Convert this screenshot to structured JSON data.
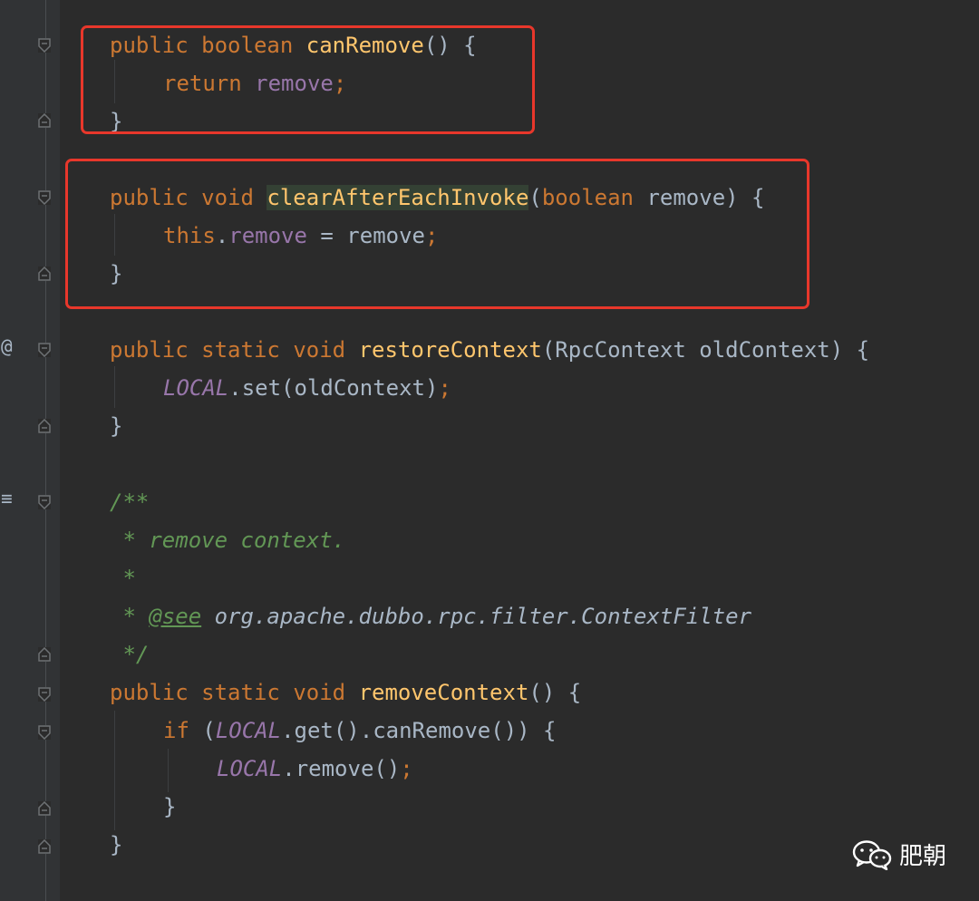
{
  "gutter": {
    "override_marker": "@",
    "doc_marker": "≡"
  },
  "code": {
    "canRemove": {
      "l1": {
        "kw1": "public",
        "kw2": "boolean",
        "name": "canRemove",
        "rest": "() {"
      },
      "l2": {
        "kw": "return",
        "field": "remove",
        "semi": ";"
      },
      "l3": {
        "brace": "}"
      }
    },
    "clearAfter": {
      "l1": {
        "kw1": "public",
        "kw2": "void",
        "name": "clearAfterEachInvoke",
        "open": "(",
        "kw3": "boolean",
        "param": "remove) {"
      },
      "l2": {
        "kw": "this",
        "dot": ".",
        "field": "remove",
        "rest": " = remove",
        "semi": ";"
      },
      "l3": {
        "brace": "}"
      }
    },
    "restore": {
      "l1": {
        "kw1": "public",
        "kw2": "static",
        "kw3": "void",
        "name": "restoreContext",
        "rest": "(RpcContext oldContext) {"
      },
      "l2": {
        "sfield": "LOCAL",
        "rest": ".set(oldContext)",
        "semi": ";"
      },
      "l3": {
        "brace": "}"
      }
    },
    "javadoc": {
      "l1": "/**",
      "l2": " * remove context.",
      "l3": " *",
      "l4_star": " * ",
      "l4_tag": "@see",
      "l4_ref": " org.apache.dubbo.rpc.filter.ContextFilter",
      "l5": " */"
    },
    "removeCtx": {
      "l1": {
        "kw1": "public",
        "kw2": "static",
        "kw3": "void",
        "name": "removeContext",
        "rest": "() {"
      },
      "l2": {
        "kw": "if",
        "open": " (",
        "sfield": "LOCAL",
        "rest": ".get().canRemove()) {"
      },
      "l3": {
        "sfield": "LOCAL",
        "rest": ".remove()",
        "semi": ";"
      },
      "l4": {
        "brace": "}"
      },
      "l5": {
        "brace": "}"
      }
    }
  },
  "watermark": {
    "icon": "wechat-icon",
    "text": "肥朝"
  },
  "colors": {
    "background": "#2b2b2b",
    "keyword": "#cc7832",
    "method": "#ffc66d",
    "field": "#9876aa",
    "comment": "#629755",
    "text": "#a9b7c6",
    "highlight_box": "#e8372b"
  }
}
